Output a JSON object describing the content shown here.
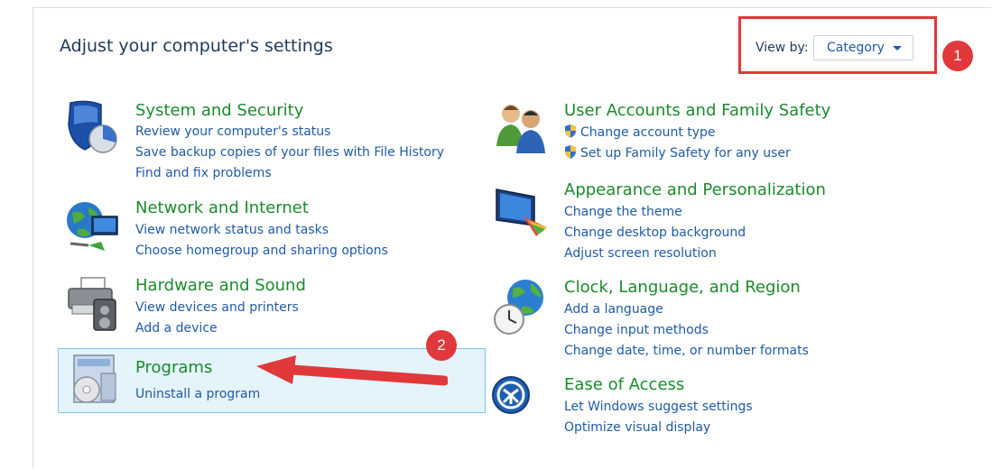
{
  "page": {
    "title": "Adjust your computer's settings"
  },
  "view_by": {
    "label": "View by:",
    "value": "Category"
  },
  "annotations": {
    "badge1": "1",
    "badge2": "2",
    "color": "#e0383b"
  },
  "left_column": [
    {
      "title": "System and Security",
      "links": [
        "Review your computer's status",
        "Save backup copies of your files with File History",
        "Find and fix problems"
      ]
    },
    {
      "title": "Network and Internet",
      "links": [
        "View network status and tasks",
        "Choose homegroup and sharing options"
      ]
    },
    {
      "title": "Hardware and Sound",
      "links": [
        "View devices and printers",
        "Add a device"
      ]
    },
    {
      "title": "Programs",
      "links": [
        "Uninstall a program"
      ]
    }
  ],
  "right_column": [
    {
      "title": "User Accounts and Family Safety",
      "links": [
        "Change account type",
        "Set up Family Safety for any user"
      ]
    },
    {
      "title": "Appearance and Personalization",
      "links": [
        "Change the theme",
        "Change desktop background",
        "Adjust screen resolution"
      ]
    },
    {
      "title": "Clock, Language, and Region",
      "links": [
        "Add a language",
        "Change input methods",
        "Change date, time, or number formats"
      ]
    },
    {
      "title": "Ease of Access",
      "links": [
        "Let Windows suggest settings",
        "Optimize visual display"
      ]
    }
  ],
  "colors": {
    "title_green": "#1b8a2c",
    "link_blue": "#1f5aa8",
    "heading_navy": "#1e395b",
    "highlight": "#e5f3fb"
  }
}
